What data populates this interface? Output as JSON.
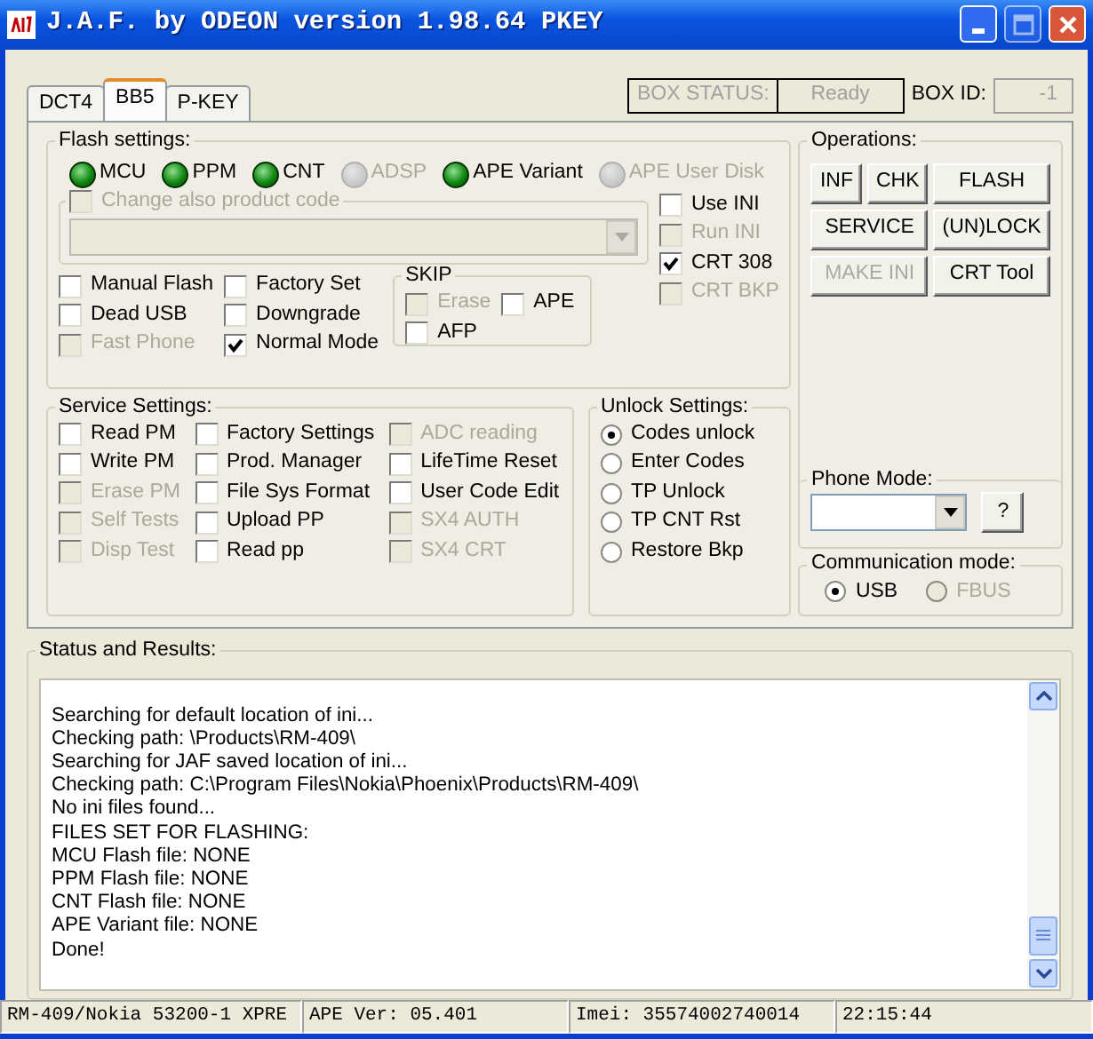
{
  "window": {
    "title": "J.A.F. by ODEON version 1.98.64 PKEY"
  },
  "tabs": [
    {
      "label": "DCT4",
      "selected": false
    },
    {
      "label": "BB5",
      "selected": true
    },
    {
      "label": "P-KEY",
      "selected": false
    }
  ],
  "box_status": {
    "label": "BOX STATUS:",
    "value": "Ready",
    "box_id_label": "BOX ID:",
    "box_id_value": "-1"
  },
  "flash_settings": {
    "title": "Flash settings:",
    "leds": [
      {
        "label": "MCU",
        "on": true
      },
      {
        "label": "PPM",
        "on": true
      },
      {
        "label": "CNT",
        "on": true
      },
      {
        "label": "ADSP",
        "on": false
      },
      {
        "label": "APE Variant",
        "on": true
      },
      {
        "label": "APE User Disk",
        "on": false
      }
    ],
    "product_code": {
      "label": "Change also product code",
      "checked": false,
      "disabled": true
    },
    "ini_options": [
      {
        "label": "Use INI",
        "checked": false,
        "disabled": false
      },
      {
        "label": "Run INI",
        "checked": false,
        "disabled": true
      },
      {
        "label": "CRT 308",
        "checked": true,
        "disabled": false
      },
      {
        "label": "CRT BKP",
        "checked": false,
        "disabled": true
      }
    ],
    "options": [
      {
        "label": "Manual Flash",
        "checked": false,
        "disabled": false
      },
      {
        "label": "Factory Set",
        "checked": false,
        "disabled": false
      },
      {
        "label": "Dead USB",
        "checked": false,
        "disabled": false
      },
      {
        "label": "Downgrade",
        "checked": false,
        "disabled": false
      },
      {
        "label": "Fast Phone",
        "checked": false,
        "disabled": true
      },
      {
        "label": "Normal Mode",
        "checked": true,
        "disabled": false
      }
    ],
    "skip": {
      "title": "SKIP",
      "items": [
        {
          "label": "Erase",
          "checked": false,
          "disabled": true
        },
        {
          "label": "APE",
          "checked": false,
          "disabled": false
        },
        {
          "label": "AFP",
          "checked": false,
          "disabled": false
        }
      ]
    }
  },
  "service_settings": {
    "title": "Service Settings:",
    "columns": [
      [
        {
          "label": "Read PM",
          "checked": false,
          "disabled": false
        },
        {
          "label": "Write PM",
          "checked": false,
          "disabled": false
        },
        {
          "label": "Erase PM",
          "checked": false,
          "disabled": true
        },
        {
          "label": "Self Tests",
          "checked": false,
          "disabled": true
        },
        {
          "label": "Disp Test",
          "checked": false,
          "disabled": true
        }
      ],
      [
        {
          "label": "Factory Settings",
          "checked": false,
          "disabled": false
        },
        {
          "label": "Prod. Manager",
          "checked": false,
          "disabled": false
        },
        {
          "label": "File Sys Format",
          "checked": false,
          "disabled": false
        },
        {
          "label": "Upload PP",
          "checked": false,
          "disabled": false
        },
        {
          "label": "Read pp",
          "checked": false,
          "disabled": false
        }
      ],
      [
        {
          "label": "ADC reading",
          "checked": false,
          "disabled": true
        },
        {
          "label": "LifeTime Reset",
          "checked": false,
          "disabled": false
        },
        {
          "label": "User Code Edit",
          "checked": false,
          "disabled": false
        },
        {
          "label": "SX4 AUTH",
          "checked": false,
          "disabled": true
        },
        {
          "label": "SX4 CRT",
          "checked": false,
          "disabled": true
        }
      ]
    ]
  },
  "unlock_settings": {
    "title": "Unlock Settings:",
    "options": [
      {
        "label": "Codes unlock",
        "selected": true
      },
      {
        "label": "Enter Codes",
        "selected": false
      },
      {
        "label": "TP Unlock",
        "selected": false
      },
      {
        "label": "TP CNT Rst",
        "selected": false
      },
      {
        "label": "Restore Bkp",
        "selected": false
      }
    ]
  },
  "operations": {
    "title": "Operations:",
    "buttons": [
      {
        "label": "INF",
        "disabled": false
      },
      {
        "label": "CHK",
        "disabled": false
      },
      {
        "label": "FLASH",
        "disabled": false
      },
      {
        "label": "SERVICE",
        "disabled": false
      },
      {
        "label": "(UN)LOCK",
        "disabled": false
      },
      {
        "label": "MAKE INI",
        "disabled": true
      },
      {
        "label": "CRT Tool",
        "disabled": false
      }
    ]
  },
  "phone_mode": {
    "title": "Phone Mode:",
    "help_button": "?"
  },
  "communication_mode": {
    "title": "Communication mode:",
    "options": [
      {
        "label": "USB",
        "selected": true,
        "disabled": false
      },
      {
        "label": "FBUS",
        "selected": false,
        "disabled": true
      }
    ]
  },
  "status": {
    "title": "Status and Results:",
    "lines": [
      "Searching for default location of ini...",
      "Checking path: \\Products\\RM-409\\",
      "Searching for JAF saved location of ini...",
      "Checking path: C:\\Program Files\\Nokia\\Phoenix\\Products\\RM-409\\",
      "No ini files found...",
      "FILES SET FOR FLASHING:",
      "MCU Flash file: NONE",
      "PPM Flash file: NONE",
      "CNT Flash file: NONE",
      "APE Variant file: NONE",
      "Done!"
    ]
  },
  "status_bar": [
    "RM-409/Nokia 53200-1 XPRE",
    "APE Ver: 05.401",
    "Imei: 35574002740014",
    "22:15:44"
  ]
}
